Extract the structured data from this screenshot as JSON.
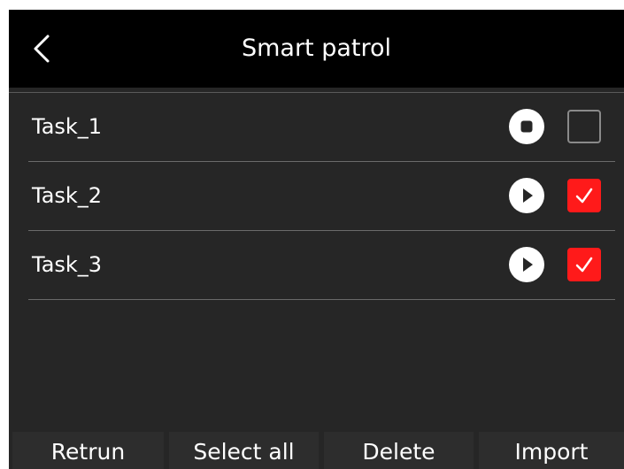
{
  "header": {
    "title": "Smart patrol",
    "back_icon": "chevron-left-icon"
  },
  "tasks": [
    {
      "name": "Task_1",
      "state": "stopped",
      "state_icon": "stop-icon",
      "checked": false
    },
    {
      "name": "Task_2",
      "state": "play",
      "state_icon": "play-icon",
      "checked": true
    },
    {
      "name": "Task_3",
      "state": "play",
      "state_icon": "play-icon",
      "checked": true
    }
  ],
  "bottom_bar": {
    "retrun_label": "Retrun",
    "select_all_label": "Select all",
    "delete_label": "Delete",
    "import_label": "Import"
  },
  "colors": {
    "header_bg": "#000000",
    "body_bg": "#262626",
    "checkbox_checked": "#ff1a1a",
    "button_bg": "#2d2d2d",
    "text": "#ffffff"
  }
}
